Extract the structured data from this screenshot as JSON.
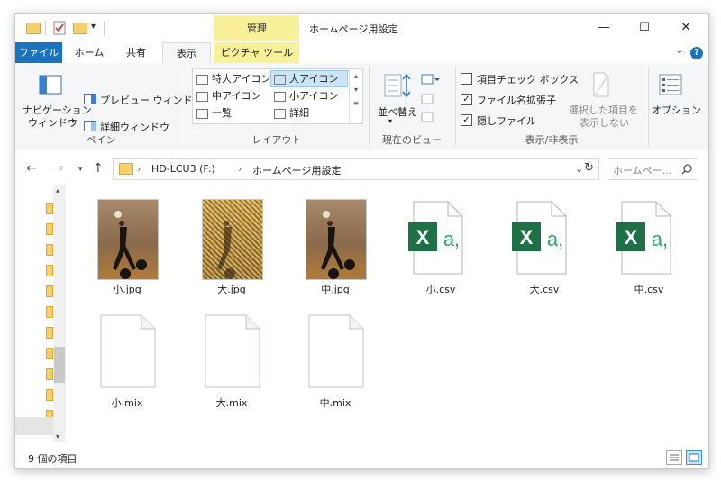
{
  "titlebar": {
    "context_tab": "管理",
    "window_title": "ホームページ用設定"
  },
  "tabs": {
    "file": "ファイル",
    "home": "ホーム",
    "share": "共有",
    "view": "表示",
    "picture_tools": "ピクチャ ツール"
  },
  "ribbon": {
    "pane": {
      "nav_pane_line1": "ナビゲーション",
      "nav_pane_line2": "ウィンドウ",
      "preview_pane": "プレビュー ウィンドウ",
      "details_pane": "詳細ウィンドウ",
      "label": "ペイン"
    },
    "layout": {
      "extra_large": "特大アイコン",
      "large": "大アイコン",
      "medium": "中アイコン",
      "small": "小アイコン",
      "list": "一覧",
      "details": "詳細",
      "label": "レイアウト"
    },
    "current_view": {
      "sort_by": "並べ替え",
      "label": "現在のビュー"
    },
    "show_hide": {
      "item_checkboxes": "項目チェック ボックス",
      "file_extensions": "ファイル名拡張子",
      "hidden_items": "隠しファイル",
      "hide_selected_line1": "選択した項目を",
      "hide_selected_line2": "表示しない",
      "label": "表示/非表示"
    },
    "options": "オプション"
  },
  "address": {
    "drive": "HD-LCU3 (F:)",
    "folder": "ホームページ用設定",
    "search_placeholder": "ホームペー..."
  },
  "files": [
    {
      "name": "小.jpg",
      "kind": "photo"
    },
    {
      "name": "大.jpg",
      "kind": "photo-noisy"
    },
    {
      "name": "中.jpg",
      "kind": "photo"
    },
    {
      "name": "小.csv",
      "kind": "excel"
    },
    {
      "name": "大.csv",
      "kind": "excel"
    },
    {
      "name": "中.csv",
      "kind": "excel"
    },
    {
      "name": "小.mix",
      "kind": "blank"
    },
    {
      "name": "大.mix",
      "kind": "blank"
    },
    {
      "name": "中.mix",
      "kind": "blank"
    }
  ],
  "status": {
    "item_count": "9 個の項目"
  },
  "colors": {
    "accent": "#1a73c0",
    "context_tab": "#f8f19a",
    "excel_green": "#1e7145",
    "selection": "#cce4f7"
  }
}
